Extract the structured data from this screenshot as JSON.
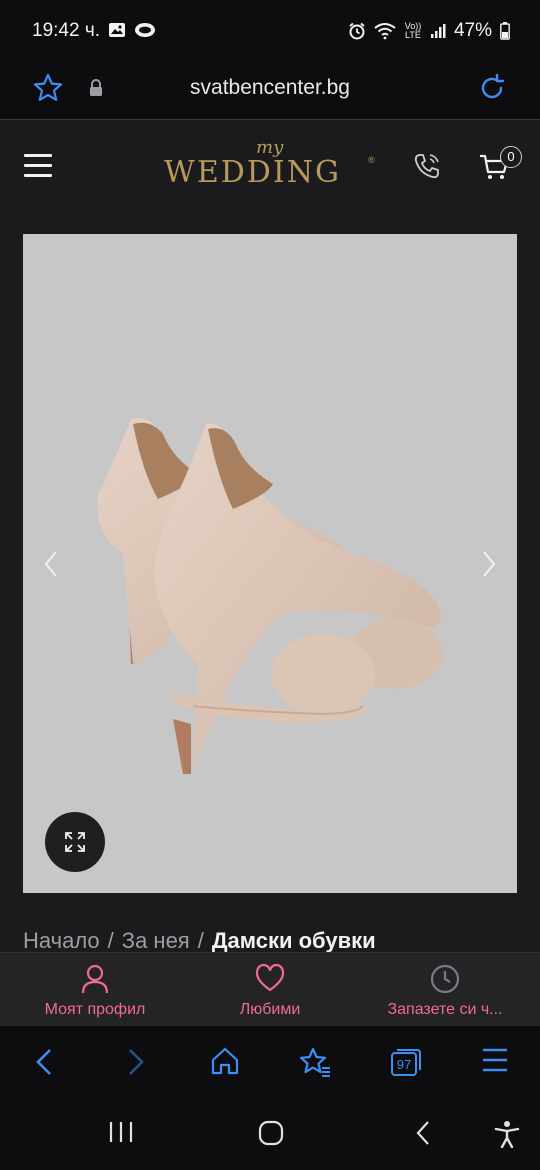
{
  "status_bar": {
    "time": "19:42 ч.",
    "network_label": "Vo)) LTE",
    "battery": "47%"
  },
  "browser": {
    "url": "svatbencenter.bg",
    "tab_count": "97"
  },
  "header": {
    "logo_small": "my",
    "logo_main": "WEDDING",
    "logo_reg": "®",
    "cart_count": "0"
  },
  "breadcrumb": {
    "items": [
      "Начало",
      "За нея"
    ],
    "current": "Дамски обувки"
  },
  "site_nav": {
    "items": [
      {
        "label": "Моят профил",
        "icon": "user-icon"
      },
      {
        "label": "Любими",
        "icon": "heart-icon"
      },
      {
        "label": "Запазете си ч...",
        "icon": "clock-icon"
      }
    ]
  },
  "colors": {
    "accent_pink": "#f06a96",
    "browser_blue": "#3d8ef2",
    "logo_gold": "#b89a5b",
    "image_bg": "#c8c7c8"
  }
}
